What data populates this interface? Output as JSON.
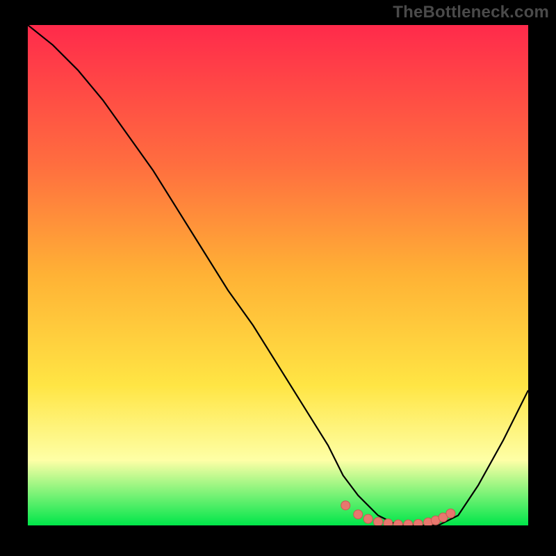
{
  "watermark": "TheBottleneck.com",
  "colors": {
    "bg": "#000000",
    "grad_top": "#ff2a4b",
    "grad_mid1": "#ff6e3f",
    "grad_mid2": "#ffb235",
    "grad_mid3": "#ffe544",
    "grad_mid4": "#feffa6",
    "grad_bottom": "#00e64a",
    "curve": "#000000",
    "dot_fill": "#e8776e",
    "dot_stroke": "#c95a53"
  },
  "chart_data": {
    "type": "line",
    "title": "",
    "xlabel": "",
    "ylabel": "",
    "xlim": [
      0,
      100
    ],
    "ylim": [
      0,
      100
    ],
    "grid": false,
    "series": [
      {
        "name": "curve",
        "x": [
          0,
          5,
          10,
          15,
          20,
          25,
          30,
          35,
          40,
          45,
          50,
          55,
          60,
          63,
          66,
          70,
          74,
          78,
          82,
          86,
          90,
          95,
          100
        ],
        "y": [
          100,
          96,
          91,
          85,
          78,
          71,
          63,
          55,
          47,
          40,
          32,
          24,
          16,
          10,
          6,
          2,
          0,
          0,
          0,
          2,
          8,
          17,
          27
        ]
      }
    ],
    "markers": {
      "name": "flat-region-dots",
      "x": [
        63.5,
        66.0,
        68.0,
        70.0,
        72.0,
        74.0,
        76.0,
        78.0,
        80.0,
        81.5,
        83.0,
        84.5
      ],
      "y": [
        4.0,
        2.2,
        1.3,
        0.7,
        0.4,
        0.2,
        0.2,
        0.3,
        0.6,
        1.0,
        1.6,
        2.4
      ]
    }
  }
}
